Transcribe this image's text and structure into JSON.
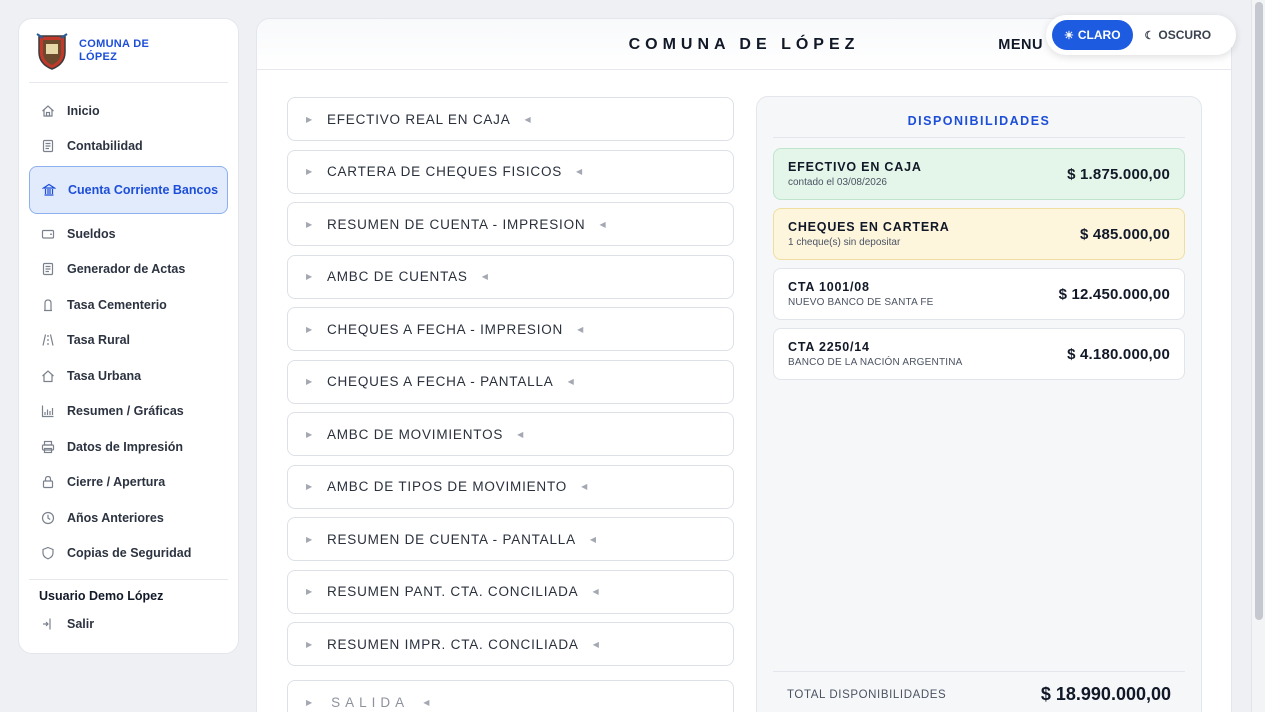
{
  "brand": {
    "name": "COMUNA DE LÓPEZ"
  },
  "header": {
    "title": "COMUNA DE LÓPEZ",
    "menu_label": "MENU"
  },
  "theme": {
    "light_label": "CLARO",
    "dark_label": "OSCURO"
  },
  "sidebar": {
    "items": [
      {
        "label": "Inicio",
        "icon": "home-icon"
      },
      {
        "label": "Contabilidad",
        "icon": "document-icon"
      },
      {
        "label": "Cuenta Corriente Bancos",
        "icon": "bank-icon",
        "active": true
      },
      {
        "label": "Sueldos",
        "icon": "wallet-icon"
      },
      {
        "label": "Generador de Actas",
        "icon": "document-icon"
      },
      {
        "label": "Tasa Cementerio",
        "icon": "tombstone-icon"
      },
      {
        "label": "Tasa Rural",
        "icon": "road-icon"
      },
      {
        "label": "Tasa Urbana",
        "icon": "house-icon"
      },
      {
        "label": "Resumen / Gráficas",
        "icon": "chart-icon"
      },
      {
        "label": "Datos de Impresión",
        "icon": "printer-icon"
      },
      {
        "label": "Cierre / Apertura",
        "icon": "lock-icon"
      },
      {
        "label": "Años Anteriores",
        "icon": "clock-icon"
      },
      {
        "label": "Copias de Seguridad",
        "icon": "shield-icon"
      }
    ],
    "user": "Usuario Demo López",
    "logout": "Salir"
  },
  "menu": {
    "items": [
      "EFECTIVO REAL EN CAJA",
      "CARTERA DE CHEQUES FISICOS",
      "RESUMEN DE CUENTA - IMPRESION",
      "AMBC DE CUENTAS",
      "CHEQUES A FECHA - IMPRESION",
      "CHEQUES A FECHA - PANTALLA",
      "AMBC DE MOVIMIENTOS",
      "AMBC DE TIPOS DE MOVIMIENTO",
      "RESUMEN DE CUENTA - PANTALLA",
      "RESUMEN PANT. CTA. CONCILIADA",
      "RESUMEN IMPR. CTA. CONCILIADA"
    ],
    "exit": "SALIDA"
  },
  "availability": {
    "title": "DISPONIBILIDADES",
    "cards": [
      {
        "title": "EFECTIVO EN CAJA",
        "sub": "contado el 03/08/2026",
        "amount": "$ 1.875.000,00"
      },
      {
        "title": "CHEQUES EN CARTERA",
        "sub": "1 cheque(s) sin depositar",
        "amount": "$ 485.000,00"
      },
      {
        "title": "CTA 1001/08",
        "sub": "NUEVO BANCO DE SANTA FE",
        "amount": "$ 12.450.000,00"
      },
      {
        "title": "CTA 2250/14",
        "sub": "BANCO DE LA NACIÓN ARGENTINA",
        "amount": "$ 4.180.000,00"
      }
    ],
    "total_label": "TOTAL DISPONIBILIDADES",
    "total_amount": "$ 18.990.000,00"
  }
}
